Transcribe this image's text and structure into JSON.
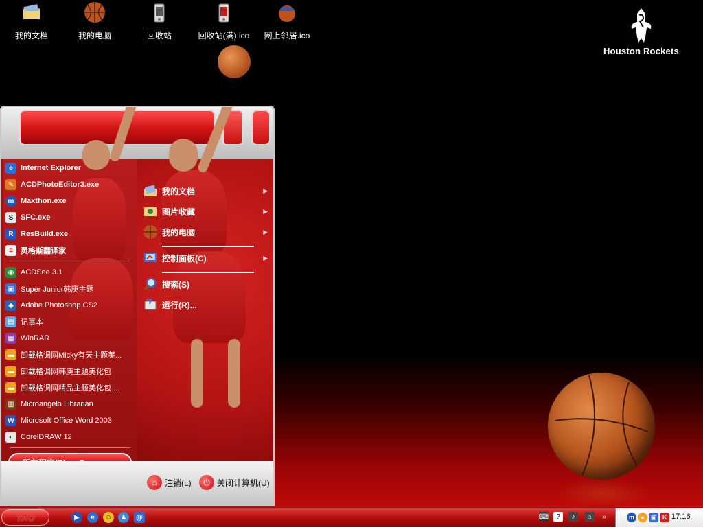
{
  "desktop_icons": [
    {
      "label": "我的文档",
      "icon": "my-documents-icon"
    },
    {
      "label": "我的电脑",
      "icon": "my-computer-icon"
    },
    {
      "label": "回收站",
      "icon": "recycle-bin-icon"
    },
    {
      "label": "回收站(满).ico",
      "icon": "recycle-bin-full-icon"
    },
    {
      "label": "网上邻居.ico",
      "icon": "network-places-icon"
    }
  ],
  "logo": {
    "text": "Houston Rockets",
    "icon": "rockets-logo-icon"
  },
  "start_menu": {
    "pinned": [
      {
        "label": "Internet Explorer",
        "icon": "ie-icon"
      },
      {
        "label": "ACDPhotoEditor3.exe",
        "icon": "acd-photo-editor-icon"
      },
      {
        "label": "Maxthon.exe",
        "icon": "maxthon-icon"
      },
      {
        "label": "SFC.exe",
        "icon": "sfc-icon"
      },
      {
        "label": "ResBuild.exe",
        "icon": "resbuild-icon"
      },
      {
        "label": "灵格斯翻译家",
        "icon": "lingoes-icon"
      }
    ],
    "recent": [
      {
        "label": "ACDSee 3.1",
        "icon": "acdsee-icon"
      },
      {
        "label": "Super Junior韩庚主题",
        "icon": "theme-icon"
      },
      {
        "label": "Adobe Photoshop CS2",
        "icon": "photoshop-icon"
      },
      {
        "label": "记事本",
        "icon": "notepad-icon"
      },
      {
        "label": "WinRAR",
        "icon": "winrar-icon"
      },
      {
        "label": "卸载格调网Micky有天主题美...",
        "icon": "uninstall-icon"
      },
      {
        "label": "卸载格调网韩庚主题美化包",
        "icon": "uninstall-icon"
      },
      {
        "label": "卸载格调网精品主题美化包 ...",
        "icon": "uninstall-icon"
      },
      {
        "label": "Microangelo Librarian",
        "icon": "microangelo-icon"
      },
      {
        "label": "Microsoft Office Word 2003",
        "icon": "word-icon"
      },
      {
        "label": "CorelDRAW 12",
        "icon": "coreldraw-icon"
      }
    ],
    "all_programs": "所有程序(P)",
    "right": [
      {
        "label": "我的文档",
        "icon": "my-documents-icon",
        "has_arrow": true
      },
      {
        "label": "图片收藏",
        "icon": "my-pictures-icon",
        "has_arrow": true
      },
      {
        "label": "我的电脑",
        "icon": "my-computer-icon",
        "has_arrow": true
      },
      {
        "label": "控制面板(C)",
        "icon": "control-panel-icon",
        "has_arrow": true
      },
      {
        "label": "搜索(S)",
        "icon": "search-icon",
        "has_arrow": false
      },
      {
        "label": "运行(R)...",
        "icon": "run-icon",
        "has_arrow": false
      }
    ],
    "logoff": "注销(L)",
    "shutdown": "关闭计算机(U)"
  },
  "taskbar": {
    "start_label": "YAO",
    "clock": "17:16"
  }
}
